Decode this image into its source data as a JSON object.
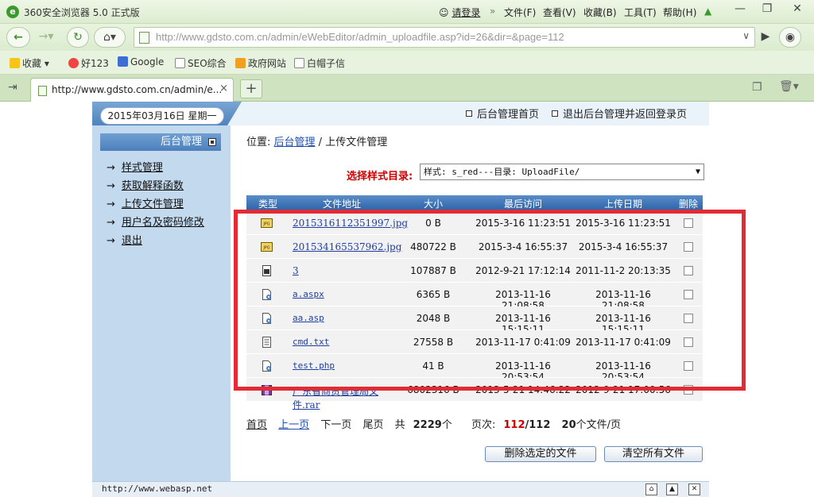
{
  "browser": {
    "title": "360安全浏览器 5.0 正式版",
    "login": "请登录",
    "menu": [
      "文件(F)",
      "查看(V)",
      "收藏(B)",
      "工具(T)",
      "帮助(H)"
    ],
    "url": "http://www.gdsto.com.cn/admin/eWebEditor/admin_uploadfile.asp?id=26&dir=&page=112",
    "bookmarks": [
      "收藏",
      "好123",
      "Google",
      "SEO综合",
      "政府网站",
      "白帽子信"
    ],
    "tab_title": "http://www.gdsto.com.cn/admin/e...",
    "tab_close": "×",
    "new_tab": "+"
  },
  "admin": {
    "date": "2015年03月16日  星期一",
    "top_links": [
      "后台管理首页",
      "退出后台管理并返回登录页"
    ],
    "sidebar_title": "后台管理",
    "sidebar_items": [
      "样式管理",
      "获取解释函数",
      "上传文件管理",
      "用户名及密码修改",
      "退出"
    ],
    "crumb_prefix": "位置: ",
    "crumb_link": "后台管理",
    "crumb_sep": " / ",
    "crumb_current": "上传文件管理",
    "style_label": "选择样式目录:",
    "style_value": "样式: s_red---目录: UploadFile/",
    "columns": [
      "类型",
      "文件地址",
      "大小",
      "最后访问",
      "上传日期",
      "删除"
    ],
    "rows": [
      {
        "icon": "jpg-file-icon",
        "name": "2015316112351997.jpg",
        "size": "0 B",
        "accessed": "2015-3-16 11:23:51",
        "uploaded": "2015-3-16 11:23:51"
      },
      {
        "icon": "jpg-file-icon",
        "name": "201534165537962.jpg",
        "size": "480722 B",
        "accessed": "2015-3-4 16:55:37",
        "uploaded": "2015-3-4 16:55:37"
      },
      {
        "icon": "generic-file-icon",
        "name": "3",
        "size": "107887 B",
        "accessed": "2012-9-21 17:12:14",
        "uploaded": "2011-11-2 20:13:35"
      },
      {
        "icon": "script-file-icon",
        "name": "a.aspx",
        "size": "6365 B",
        "accessed": "2013-11-16 21:08:58",
        "uploaded": "2013-11-16 21:08:58"
      },
      {
        "icon": "script-file-icon",
        "name": "aa.asp",
        "size": "2048 B",
        "accessed": "2013-11-16 15:15:11",
        "uploaded": "2013-11-16 15:15:11"
      },
      {
        "icon": "text-file-icon",
        "name": "cmd.txt",
        "size": "27558 B",
        "accessed": "2013-11-17 0:41:09",
        "uploaded": "2013-11-17 0:41:09"
      },
      {
        "icon": "script-file-icon",
        "name": "test.php",
        "size": "41 B",
        "accessed": "2013-11-16 20:53:54",
        "uploaded": "2013-11-16 20:53:54"
      },
      {
        "icon": "rar-file-icon",
        "name": "广东省商贸管理局文件.rar",
        "size": "6802316 B",
        "accessed": "2013-5-21 14:46:22",
        "uploaded": "2012-9-21 17:00:56"
      }
    ],
    "pager": {
      "first": "首页",
      "prev": "上一页",
      "next": "下一页",
      "last": "尾页",
      "total_prefix": "共",
      "total": "2229",
      "total_suffix": "个",
      "page_prefix": "页次:",
      "page_current": "112",
      "page_total": "/112",
      "per_page": "20",
      "per_suffix": "个文件/页"
    },
    "buttons": {
      "delete_selected": "删除选定的文件",
      "clear_all": "清空所有文件"
    },
    "footer_text": "http://www.webasp.net"
  },
  "colors": {
    "highlight_box": "#e32b35",
    "header_blue": "#2e67ad",
    "panel_blue": "#c3d9ee"
  }
}
